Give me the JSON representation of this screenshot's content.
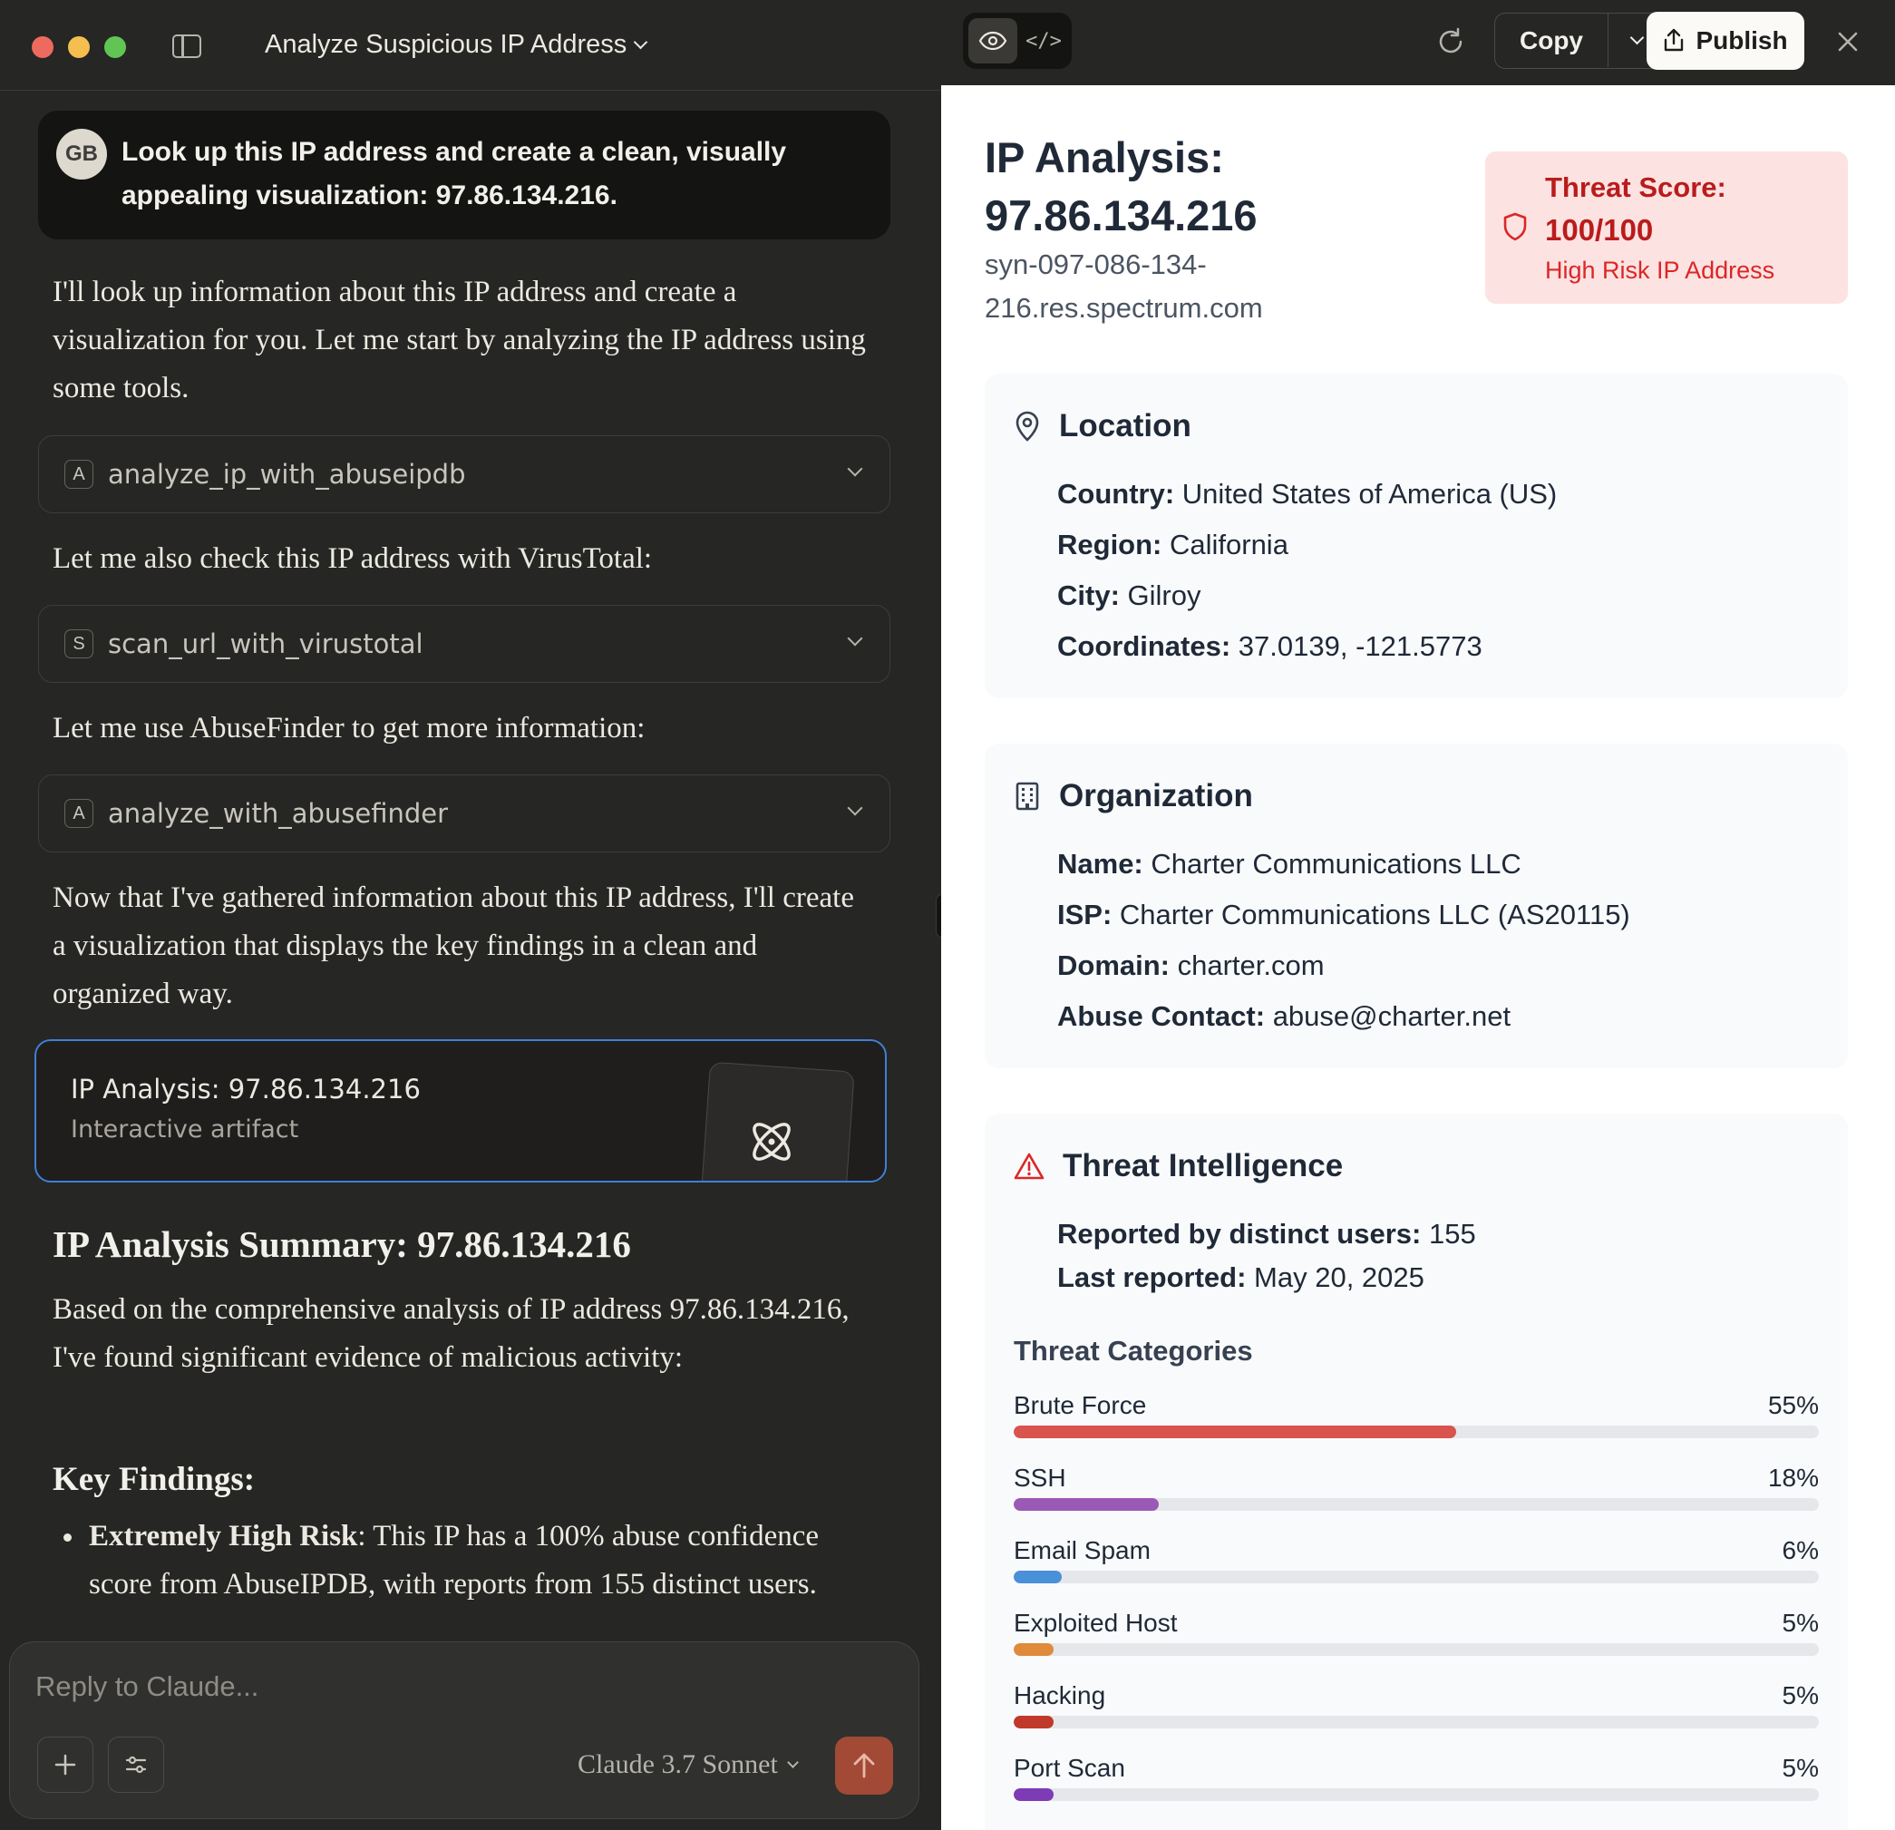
{
  "chat": {
    "title": "Analyze Suspicious IP Address",
    "user": {
      "initials": "GB",
      "message": "Look up this IP address and create a clean, visually appealing visualization: 97.86.134.216."
    },
    "intro": "I'll look up information about this IP address and create a visualization for you. Let me start by analyzing the IP address using some tools.",
    "tools": [
      {
        "badge": "A",
        "name": "analyze_ip_with_abuseipdb"
      },
      {
        "badge": "S",
        "name": "scan_url_with_virustotal"
      },
      {
        "badge": "A",
        "name": "analyze_with_abusefinder"
      }
    ],
    "virustotal_text": "Let me also check this IP address with VirusTotal:",
    "abusefinder_text": "Let me use AbuseFinder to get more information:",
    "visualization_text": "Now that I've gathered information about this IP address, I'll create a visualization that displays the key findings in a clean and organized way.",
    "artifact": {
      "title": "IP Analysis: 97.86.134.216",
      "subtitle": "Interactive artifact"
    },
    "summary_heading": "IP Analysis Summary: 97.86.134.216",
    "summary_text": "Based on the comprehensive analysis of IP address 97.86.134.216, I've found significant evidence of malicious activity:",
    "key_findings_heading": "Key Findings:",
    "finding_1": {
      "label": "Extremely High Risk",
      "text": ": This IP has a 100% abuse confidence score from AbuseIPDB, with reports from 155 distinct users."
    },
    "composer": {
      "placeholder": "Reply to Claude...",
      "model": "Claude 3.7 Sonnet"
    }
  },
  "artifact_panel": {
    "toolbar": {
      "code_label": "</>",
      "copy_label": "Copy",
      "publish_label": "Publish"
    },
    "header": {
      "title": "IP Analysis: 97.86.134.216",
      "hostname": "syn-097-086-134-216.res.spectrum.com"
    },
    "threat": {
      "label": "Threat Score:",
      "score": "100/100",
      "subtitle": "High Risk IP Address"
    },
    "location": {
      "heading": "Location",
      "fields": [
        {
          "key": "Country:",
          "value": " United States of America (US)"
        },
        {
          "key": "Region:",
          "value": " California"
        },
        {
          "key": "City:",
          "value": " Gilroy"
        },
        {
          "key": "Coordinates:",
          "value": " 37.0139, -121.5773"
        }
      ]
    },
    "organization": {
      "heading": "Organization",
      "fields": [
        {
          "key": "Name:",
          "value": " Charter Communications LLC"
        },
        {
          "key": "ISP:",
          "value": " Charter Communications LLC (AS20115)"
        },
        {
          "key": "Domain:",
          "value": " charter.com"
        },
        {
          "key": "Abuse Contact:",
          "value": " abuse@charter.net"
        }
      ]
    },
    "threat_intel": {
      "heading": "Threat Intelligence",
      "fields": [
        {
          "key": "Reported by distinct users:",
          "value": " 155"
        },
        {
          "key": "Last reported:",
          "value": " May 20, 2025"
        }
      ],
      "categories_heading": "Threat Categories",
      "categories": [
        {
          "name": "Brute Force",
          "pct_label": "55%",
          "value": 55,
          "color": "#d9534f"
        },
        {
          "name": "SSH",
          "pct_label": "18%",
          "value": 18,
          "color": "#9b59b6"
        },
        {
          "name": "Email Spam",
          "pct_label": "6%",
          "value": 6,
          "color": "#4a90d9"
        },
        {
          "name": "Exploited Host",
          "pct_label": "5%",
          "value": 5,
          "color": "#e08a3c"
        },
        {
          "name": "Hacking",
          "pct_label": "5%",
          "value": 5,
          "color": "#c0392b"
        },
        {
          "name": "Port Scan",
          "pct_label": "5%",
          "value": 5,
          "color": "#7d3cb5"
        }
      ]
    }
  }
}
